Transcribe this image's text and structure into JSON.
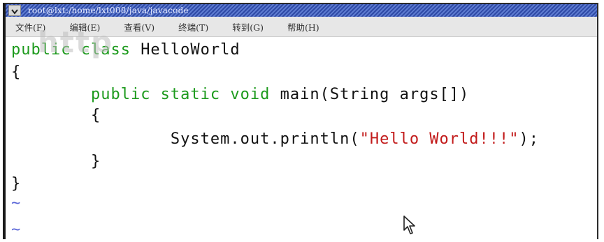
{
  "window": {
    "title": "root@lxt:/home/lxt008/java/javacode"
  },
  "menu": {
    "items": [
      {
        "label": "文件(F)"
      },
      {
        "label": "编辑(E)"
      },
      {
        "label": "查看(V)"
      },
      {
        "label": "终端(T)"
      },
      {
        "label": "转到(G)"
      },
      {
        "label": "帮助(H)"
      }
    ]
  },
  "code": {
    "l1_kw": "public class ",
    "l1_name": "HelloWorld",
    "l2": "{",
    "l3_indent": "        ",
    "l3_kw": "public static void",
    "l3_rest": " main(String args[])",
    "l4": "        {",
    "l5_prefix": "                System.out.println(",
    "l5_str": "\"Hello World!!!\"",
    "l5_suffix": ");",
    "l6": "        }",
    "l7": "}",
    "tilde": "~"
  },
  "watermark": {
    "text": "http"
  },
  "colors": {
    "keyword": "#1c9a1c",
    "string": "#c21a1a",
    "tilde": "#5a66d8",
    "titlebar": "#2f4aa6"
  }
}
